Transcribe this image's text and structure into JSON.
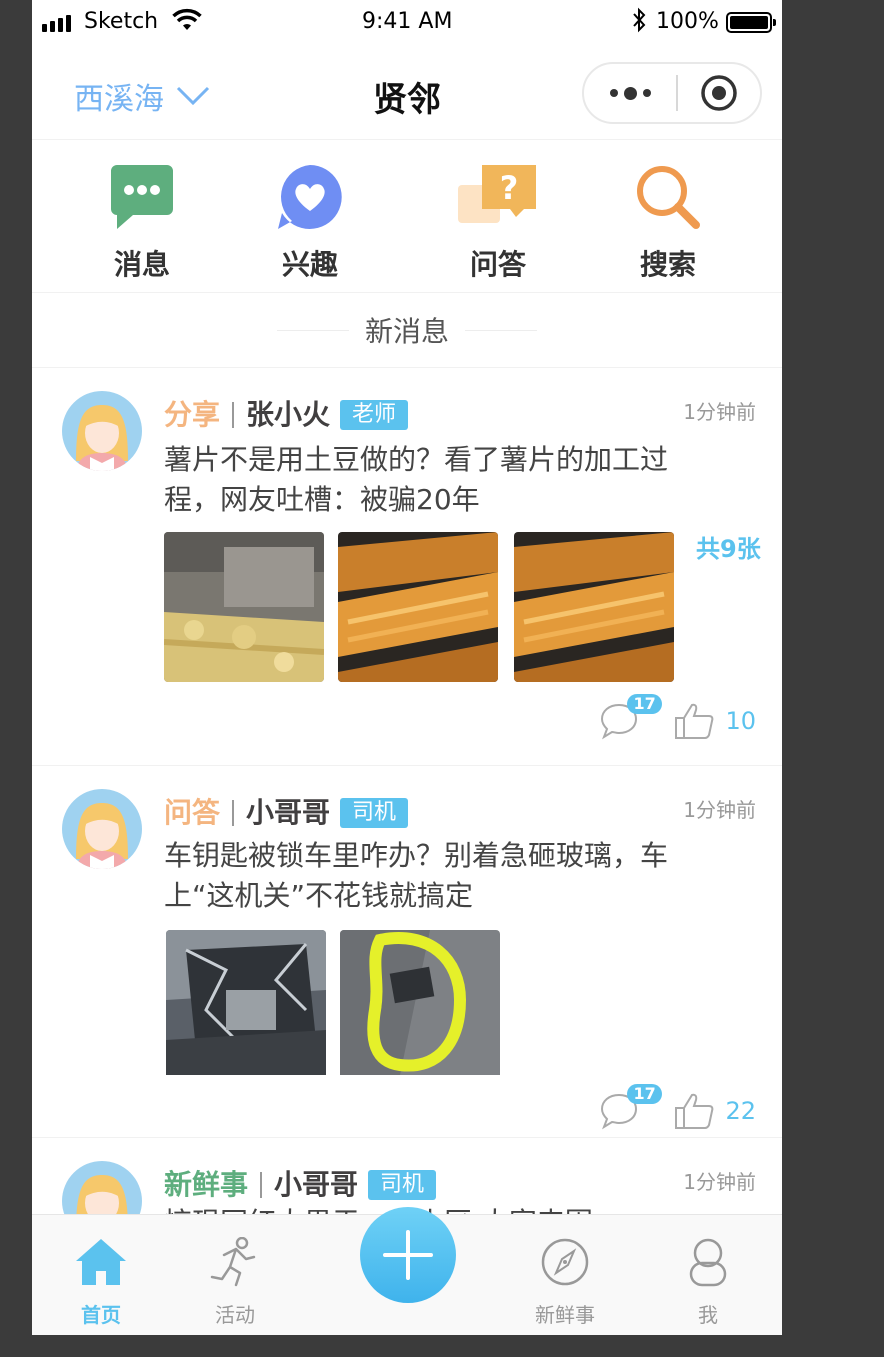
{
  "status_bar": {
    "carrier": "Sketch",
    "time": "9:41 AM",
    "battery": "100%"
  },
  "nav": {
    "location": "西溪海",
    "title": "贤邻",
    "location_color": "#77b4f3"
  },
  "quick_entries": [
    {
      "label": "消息",
      "icon": "message-icon"
    },
    {
      "label": "兴趣",
      "icon": "heart-icon"
    },
    {
      "label": "问答",
      "icon": "question-icon"
    },
    {
      "label": "搜索",
      "icon": "search-icon"
    }
  ],
  "new_messages_label": "新消息",
  "posts": [
    {
      "type": "分享",
      "type_color": "#f4b580",
      "author": "张小火",
      "tag": "老师",
      "time": "1分钟前",
      "text": "薯片不是用土豆做的？看了薯片的加工过程，网友吐槽：被骗20年",
      "more_images": "共9张",
      "comments": "17",
      "likes": "10"
    },
    {
      "type": "问答",
      "type_color": "#f4b580",
      "author": "小哥哥",
      "tag": "司机",
      "time": "1分钟前",
      "text": "车钥匙被锁车里咋办？别着急砸玻璃，车上“这机关”不花钱就搞定",
      "comments": "17",
      "likes": "22"
    },
    {
      "type": "新鲜事",
      "type_color": "#5eae7e",
      "author": "小哥哥",
      "tag": "司机",
      "time": "1分钟前",
      "text": "惊现网红大男于…我小区 大家来围"
    }
  ],
  "tabs": [
    {
      "label": "首页",
      "icon": "home-icon"
    },
    {
      "label": "活动",
      "icon": "running-icon"
    },
    {
      "label": "",
      "icon": "plus-icon"
    },
    {
      "label": "新鲜事",
      "icon": "compass-icon"
    },
    {
      "label": "我",
      "icon": "profile-icon"
    }
  ],
  "colors": {
    "accent": "#5bc2ee",
    "name": "#413f40",
    "divider": "rgb(241,241,241)",
    "tag_text": "#fffeff"
  }
}
